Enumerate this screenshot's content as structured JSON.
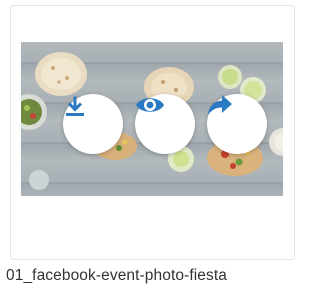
{
  "file": {
    "name": "01_facebook-event-photo-fiesta",
    "thumbnail_alt": "Tortillas, tacos and drinks on a rustic wooden table"
  },
  "actions": [
    {
      "name": "download",
      "icon": "download-icon"
    },
    {
      "name": "preview",
      "icon": "eye-icon"
    },
    {
      "name": "share",
      "icon": "share-arrow-icon"
    }
  ],
  "colors": {
    "accent": "#2b79c2",
    "card_border": "#e3e3e3",
    "text": "#333333"
  }
}
